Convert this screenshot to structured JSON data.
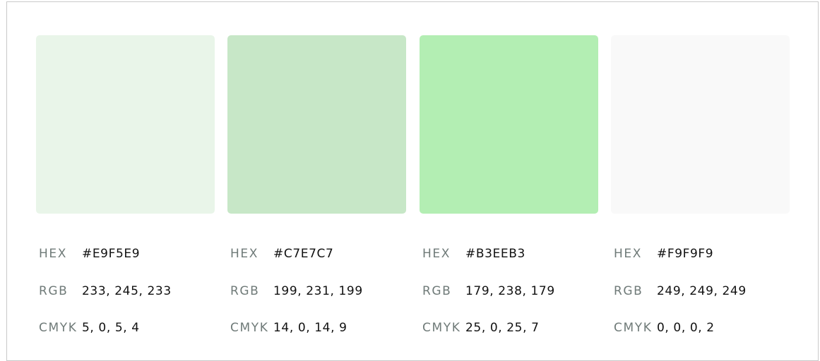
{
  "labels": {
    "hex": "HEX",
    "rgb": "RGB",
    "cmyk": "CMYK"
  },
  "colors": [
    {
      "hex": "#E9F5E9",
      "rgb": "233, 245, 233",
      "cmyk": "5, 0, 5, 4",
      "swatch": "#E9F5E9"
    },
    {
      "hex": "#C7E7C7",
      "rgb": "199, 231, 199",
      "cmyk": "14, 0, 14, 9",
      "swatch": "#C7E7C7"
    },
    {
      "hex": "#B3EEB3",
      "rgb": "179, 238, 179",
      "cmyk": "25, 0, 25, 7",
      "swatch": "#B3EEB3"
    },
    {
      "hex": "#F9F9F9",
      "rgb": "249, 249, 249",
      "cmyk": "0, 0, 0, 2",
      "swatch": "#F9F9F9"
    }
  ]
}
